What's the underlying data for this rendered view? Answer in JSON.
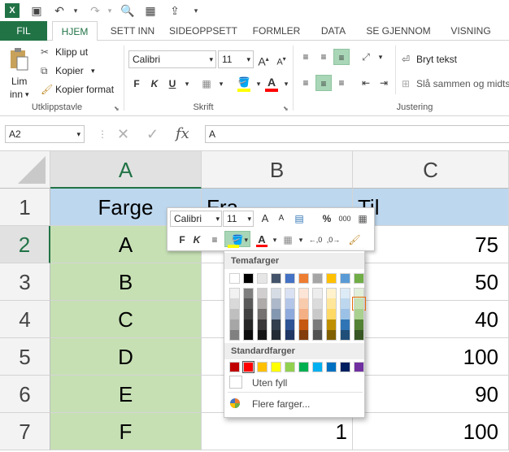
{
  "tabs": [
    "FIL",
    "HJEM",
    "SETT INN",
    "SIDEOPPSETT",
    "FORMLER",
    "DATA",
    "SE GJENNOM",
    "VISNING"
  ],
  "ribbon": {
    "paste_line1": "Lim",
    "paste_line2": "inn",
    "cut": "Klipp ut",
    "copy": "Kopier",
    "format_painter": "Kopier format",
    "group_clipboard": "Utklippstavle",
    "font_name": "Calibri",
    "font_size": "11",
    "group_font": "Skrift",
    "wrap_text": "Bryt tekst",
    "merge": "Slå sammen og midts",
    "group_alignment": "Justering",
    "bold": "F",
    "italic": "K",
    "underline": "U"
  },
  "formula_bar": {
    "name_box": "A2",
    "fx": "fx",
    "content": "A"
  },
  "columns": [
    "A",
    "B",
    "C"
  ],
  "rows": [
    {
      "num": "1",
      "a": "Farge",
      "b": "Fra",
      "c": "Til"
    },
    {
      "num": "2",
      "a": "A",
      "b": "",
      "c": "75"
    },
    {
      "num": "3",
      "a": "B",
      "b": "",
      "c": "50"
    },
    {
      "num": "4",
      "a": "C",
      "b": "",
      "c": "40"
    },
    {
      "num": "5",
      "a": "D",
      "b": "",
      "c": "100"
    },
    {
      "num": "6",
      "a": "E",
      "b": "",
      "c": "90"
    },
    {
      "num": "7",
      "a": "F",
      "b": "1",
      "c": "100"
    }
  ],
  "mini_toolbar": {
    "font": "Calibri",
    "size": "11",
    "bold": "F",
    "italic": "K",
    "percent": "%",
    "thousands": "000"
  },
  "palette": {
    "theme_title": "Temafarger",
    "standard_title": "Standardfarger",
    "no_fill": "Uten fyll",
    "more_colors": "Flere farger...",
    "theme_top": [
      "#ffffff",
      "#000000",
      "#e7e6e6",
      "#44546a",
      "#4472c4",
      "#ed7d31",
      "#a5a5a5",
      "#ffc000",
      "#5b9bd5",
      "#70ad47"
    ],
    "theme_shades": [
      [
        "#f2f2f2",
        "#7f7f7f",
        "#d0cece",
        "#d6dce4",
        "#d9e1f2",
        "#fce4d6",
        "#ededed",
        "#fff2cc",
        "#ddebf7",
        "#e2efda"
      ],
      [
        "#d9d9d9",
        "#595959",
        "#aeaaaa",
        "#adb9ca",
        "#b4c6e7",
        "#f8cbad",
        "#dbdbdb",
        "#ffe699",
        "#bdd7ee",
        "#c6e0b4"
      ],
      [
        "#bfbfbf",
        "#404040",
        "#757171",
        "#8497b0",
        "#8ea9db",
        "#f4b084",
        "#c9c9c9",
        "#ffd966",
        "#9bc2e6",
        "#a9d08e"
      ],
      [
        "#a6a6a6",
        "#262626",
        "#3a3838",
        "#333f4f",
        "#2f5496",
        "#c65911",
        "#7b7b7b",
        "#bf8f00",
        "#2f75b5",
        "#548235"
      ],
      [
        "#808080",
        "#0d0d0d",
        "#161616",
        "#222b35",
        "#203764",
        "#833c0c",
        "#525252",
        "#806000",
        "#1f4e78",
        "#375623"
      ]
    ],
    "standard": [
      "#c00000",
      "#ff0000",
      "#ffc000",
      "#ffff00",
      "#92d050",
      "#00b050",
      "#00b0f0",
      "#0070c0",
      "#002060",
      "#7030a0"
    ]
  }
}
